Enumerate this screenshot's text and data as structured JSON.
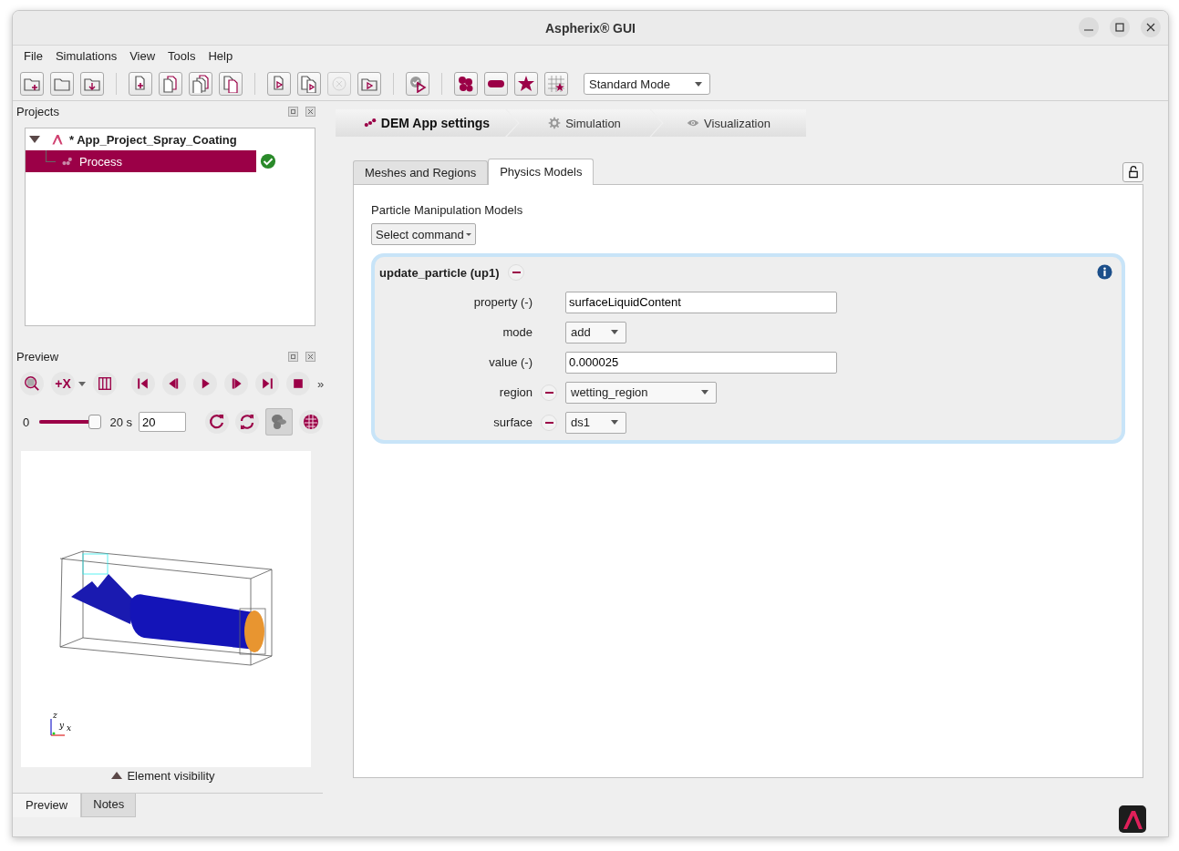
{
  "window": {
    "title": "Aspherix® GUI"
  },
  "menu": [
    "File",
    "Simulations",
    "View",
    "Tools",
    "Help"
  ],
  "toolbar": {
    "groups": [
      [
        {
          "kind": "folder-plus",
          "disabled": false
        },
        {
          "kind": "folder",
          "disabled": false
        },
        {
          "kind": "folder-down",
          "disabled": false
        }
      ],
      [
        {
          "kind": "file-plus",
          "disabled": false
        },
        {
          "kind": "files",
          "disabled": false
        },
        {
          "kind": "files-stack",
          "disabled": false
        },
        {
          "kind": "files-offset",
          "disabled": false
        }
      ],
      [
        {
          "kind": "file-play",
          "disabled": false
        },
        {
          "kind": "files-play",
          "disabled": false
        },
        {
          "kind": "cancel",
          "disabled": true
        },
        {
          "kind": "folder-play",
          "disabled": false
        }
      ],
      [
        {
          "kind": "check-play",
          "disabled": false
        }
      ],
      [
        {
          "kind": "particles",
          "disabled": false
        },
        {
          "kind": "capsule",
          "disabled": false
        },
        {
          "kind": "star",
          "disabled": false
        },
        {
          "kind": "grid-star",
          "disabled": false
        }
      ]
    ],
    "mode": "Standard Mode"
  },
  "projects": {
    "title": "Projects",
    "tree": [
      {
        "label": "* App_Project_Spray_Coating",
        "expanded": true,
        "children": [
          {
            "label": "Process",
            "selected": true,
            "valid": true
          }
        ]
      }
    ]
  },
  "preview": {
    "title": "Preview",
    "axis_button": "+X",
    "more": "»",
    "controls": [
      {
        "kind": "skip-start"
      },
      {
        "kind": "step-back"
      },
      {
        "kind": "play"
      },
      {
        "kind": "step-forward"
      },
      {
        "kind": "skip-end"
      },
      {
        "kind": "stop"
      }
    ],
    "time_start": "0",
    "slider": {
      "level": 1
    },
    "time_end": "20 s",
    "time_value": "20",
    "view_buttons": [
      {
        "kind": "reload",
        "selected": false
      },
      {
        "kind": "sync",
        "selected": false
      },
      {
        "kind": "particles",
        "selected": true
      },
      {
        "kind": "sphere",
        "selected": false
      }
    ],
    "axes": [
      "z",
      "y",
      "x"
    ],
    "element_visibility": "Element visibility"
  },
  "bottom_tabs": [
    {
      "label": "Preview",
      "selected": true
    },
    {
      "label": "Notes",
      "selected": false
    }
  ],
  "steps": [
    {
      "label": "DEM App settings",
      "selected": true,
      "kind": "particles"
    },
    {
      "label": "Simulation",
      "selected": false,
      "kind": "gear"
    },
    {
      "label": "Visualization",
      "selected": false,
      "kind": "eye"
    }
  ],
  "tabs": [
    {
      "label": "Meshes and Regions",
      "selected": false
    },
    {
      "label": "Physics Models",
      "selected": true
    }
  ],
  "section": {
    "title": "Particle Manipulation Models",
    "command": "Select command"
  },
  "model": {
    "title": "update_particle (up1)",
    "fields": [
      {
        "label": "property (-)",
        "kind": "text",
        "value": "surfaceLiquidContent",
        "removable": false
      },
      {
        "label": "mode",
        "kind": "combo",
        "value": "add",
        "removable": false
      },
      {
        "label": "value (-)",
        "kind": "text",
        "value": "0.000025",
        "removable": false
      },
      {
        "label": "region",
        "kind": "combo",
        "value": "wetting_region",
        "removable": true
      },
      {
        "label": "surface",
        "kind": "combo",
        "value": "ds1",
        "removable": true
      }
    ]
  }
}
